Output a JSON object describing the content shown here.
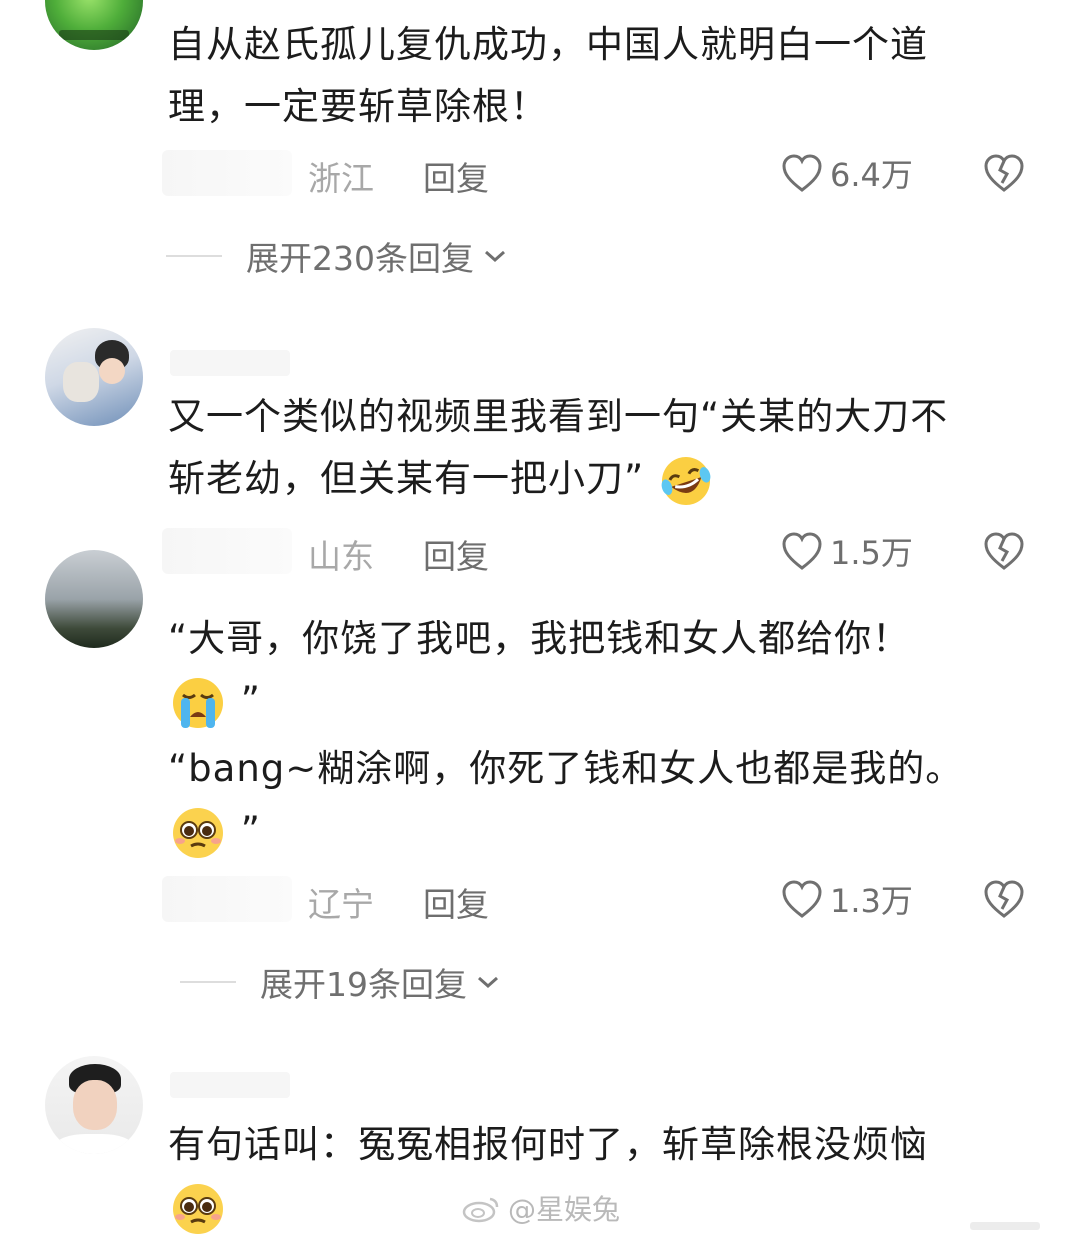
{
  "comments": [
    {
      "text_lines": [
        "自从赵氏孤儿复仇成功，中国人就明白一个道",
        "理，一定要斩草除根！"
      ],
      "region": "浙江",
      "reply_label": "回复",
      "likes": "6.4万",
      "expand_label": "展开230条回复"
    },
    {
      "text_lines": [
        "又一个类似的视频里我看到一句“关某的大刀不",
        "斩老幼，但关某有一把小刀”"
      ],
      "emoji": "rofl-emoji",
      "region": "山东",
      "reply_label": "回复",
      "likes": "1.5万"
    },
    {
      "text_line1": "“大哥，你饶了我吧，我把钱和女人都给你！",
      "quote_close_1": "”",
      "text_line3": "“bang~糊涂啊，你死了钱和女人也都是我的。",
      "quote_close_2": "”",
      "emoji1": "loudly-crying-emoji",
      "emoji2": "pleading-emoji",
      "region": "辽宁",
      "reply_label": "回复",
      "likes": "1.3万",
      "expand_label": "展开19条回复"
    },
    {
      "text_lines": [
        "有句话叫：冤冤相报何时了，斩草除根没烦恼"
      ],
      "emoji": "pleading-emoji"
    }
  ],
  "watermark": "@星娱兔",
  "icons": {
    "like": "heart-outline-icon",
    "dislike": "broken-heart-icon",
    "expand": "chevron-down-icon",
    "watermark": "weibo-logo-icon"
  }
}
